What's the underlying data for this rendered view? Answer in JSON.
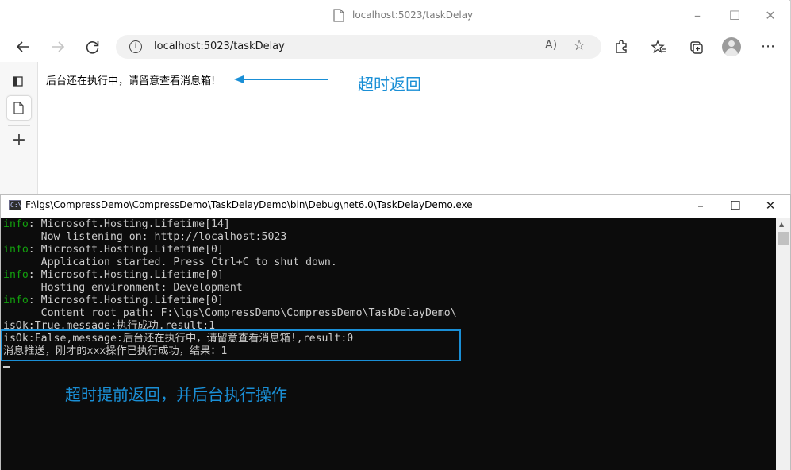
{
  "browser": {
    "title": "localhost:5023/taskDelay",
    "address_url": "localhost:5023/taskDelay",
    "read_aloud_glyph": "A)",
    "page_text": "后台还在执行中，请留意查看消息箱!",
    "icons": [
      "page-icon",
      "back-icon",
      "forward-icon",
      "refresh-icon",
      "info-icon",
      "read-aloud-icon",
      "add-favorite-icon",
      "extensions-icon",
      "favorites-icon",
      "collections-icon",
      "profile-icon",
      "more-icon",
      "tab-actions-icon",
      "page-tab-icon",
      "new-tab-icon"
    ]
  },
  "annotations": {
    "top": "超时返回",
    "bottom": "超时提前返回，并后台执行操作",
    "color": "#1a8fd6"
  },
  "console": {
    "title": "F:\\lgs\\CompressDemo\\CompressDemo\\TaskDelayDemo\\bin\\Debug\\net6.0\\TaskDelayDemo.exe",
    "icon_glyph": "C:\\",
    "info_color": "#13a10e",
    "lines": [
      {
        "prefix": "info",
        "text": ": Microsoft.Hosting.Lifetime[14]"
      },
      {
        "prefix": "",
        "text": "      Now listening on: http://localhost:5023"
      },
      {
        "prefix": "info",
        "text": ": Microsoft.Hosting.Lifetime[0]"
      },
      {
        "prefix": "",
        "text": "      Application started. Press Ctrl+C to shut down."
      },
      {
        "prefix": "info",
        "text": ": Microsoft.Hosting.Lifetime[0]"
      },
      {
        "prefix": "",
        "text": "      Hosting environment: Development"
      },
      {
        "prefix": "info",
        "text": ": Microsoft.Hosting.Lifetime[0]"
      },
      {
        "prefix": "",
        "text": "      Content root path: F:\\lgs\\CompressDemo\\CompressDemo\\TaskDelayDemo\\"
      },
      {
        "prefix": "",
        "text": "isOk:True,message:执行成功,result:1"
      },
      {
        "prefix": "",
        "text": "isOk:False,message:后台还在执行中，请留意查看消息箱!,result:0"
      },
      {
        "prefix": "",
        "text": "消息推送，刚才的xxx操作已执行成功，结果：1"
      }
    ]
  }
}
